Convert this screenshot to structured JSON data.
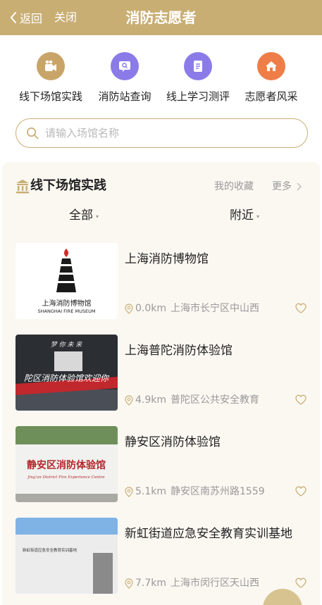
{
  "header": {
    "back_label": "返回",
    "close_label": "关闭",
    "title": "消防志愿者"
  },
  "quick_actions": [
    {
      "label": "线下场馆实践",
      "icon": "video-camera-icon",
      "color": "#c9a469"
    },
    {
      "label": "消防站查询",
      "icon": "search-chat-icon",
      "color": "#8b7be8"
    },
    {
      "label": "线上学习测评",
      "icon": "checklist-icon",
      "color": "#8b7be8"
    },
    {
      "label": "志愿者风采",
      "icon": "house-icon",
      "color": "#ee7d48"
    }
  ],
  "search": {
    "placeholder": "请输入场馆名称"
  },
  "section": {
    "title": "线下场馆实践",
    "favorites_label": "我的收藏",
    "more_label": "更多"
  },
  "filters": {
    "all_label": "全部",
    "nearby_label": "附近"
  },
  "venues": [
    {
      "name": "上海消防博物馆",
      "distance": "0.0km",
      "address": "上海市长宁区中山西",
      "thumb_text": "上海消防博物馆",
      "thumb_subtext": "SHANGHAI FIRE MUSEUM"
    },
    {
      "name": "上海普陀消防体验馆",
      "distance": "4.9km",
      "address": "普陀区公共安全教育",
      "thumb_text": "陀区消防体验馆欢迎你",
      "thumb_subtext": "梦 你 未 来"
    },
    {
      "name": "静安区消防体验馆",
      "distance": "5.1km",
      "address": "静安区南苏州路1559",
      "thumb_text": "静安区消防体验馆",
      "thumb_subtext": "Jing'an District Fire Experience Centre"
    },
    {
      "name": "新虹街道应急安全教育实训基地",
      "distance": "7.7km",
      "address": "上海市闵行区天山西",
      "thumb_text": "新虹街道应急安全教育实训基地",
      "thumb_subtext": ""
    }
  ],
  "colors": {
    "brand": "#c9ae74",
    "panel_bg": "#fbf8f2",
    "muted_text": "#999999"
  }
}
